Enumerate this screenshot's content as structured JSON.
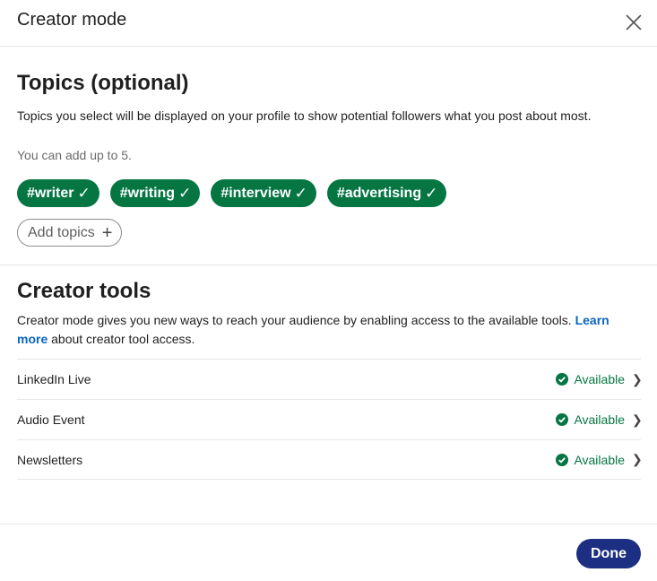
{
  "header": {
    "title": "Creator mode",
    "close_icon": "close-icon"
  },
  "topics": {
    "title": "Topics (optional)",
    "description": "Topics you select will be displayed on your profile to show potential followers what you post about most.",
    "hint": "You can add up to 5.",
    "chips": [
      {
        "label": "#writer",
        "check": "✓"
      },
      {
        "label": "#writing",
        "check": "✓"
      },
      {
        "label": "#interview",
        "check": "✓"
      },
      {
        "label": "#advertising",
        "check": "✓"
      }
    ],
    "add_button": {
      "label": "Add topics",
      "icon": "+"
    }
  },
  "tools": {
    "title": "Creator tools",
    "description_prefix": "Creator mode gives you new ways to reach your audience by enabling access to the available tools. ",
    "link_text": "Learn more",
    "description_suffix": " about creator tool access.",
    "items": [
      {
        "name": "LinkedIn Live",
        "status": "Available",
        "chevron": "❯"
      },
      {
        "name": "Audio Event",
        "status": "Available",
        "chevron": "❯"
      },
      {
        "name": "Newsletters",
        "status": "Available",
        "chevron": "❯"
      }
    ]
  },
  "footer": {
    "done_label": "Done"
  },
  "colors": {
    "accent_green": "#057642",
    "primary_button": "#1d2f82",
    "link": "#0a66c2"
  }
}
